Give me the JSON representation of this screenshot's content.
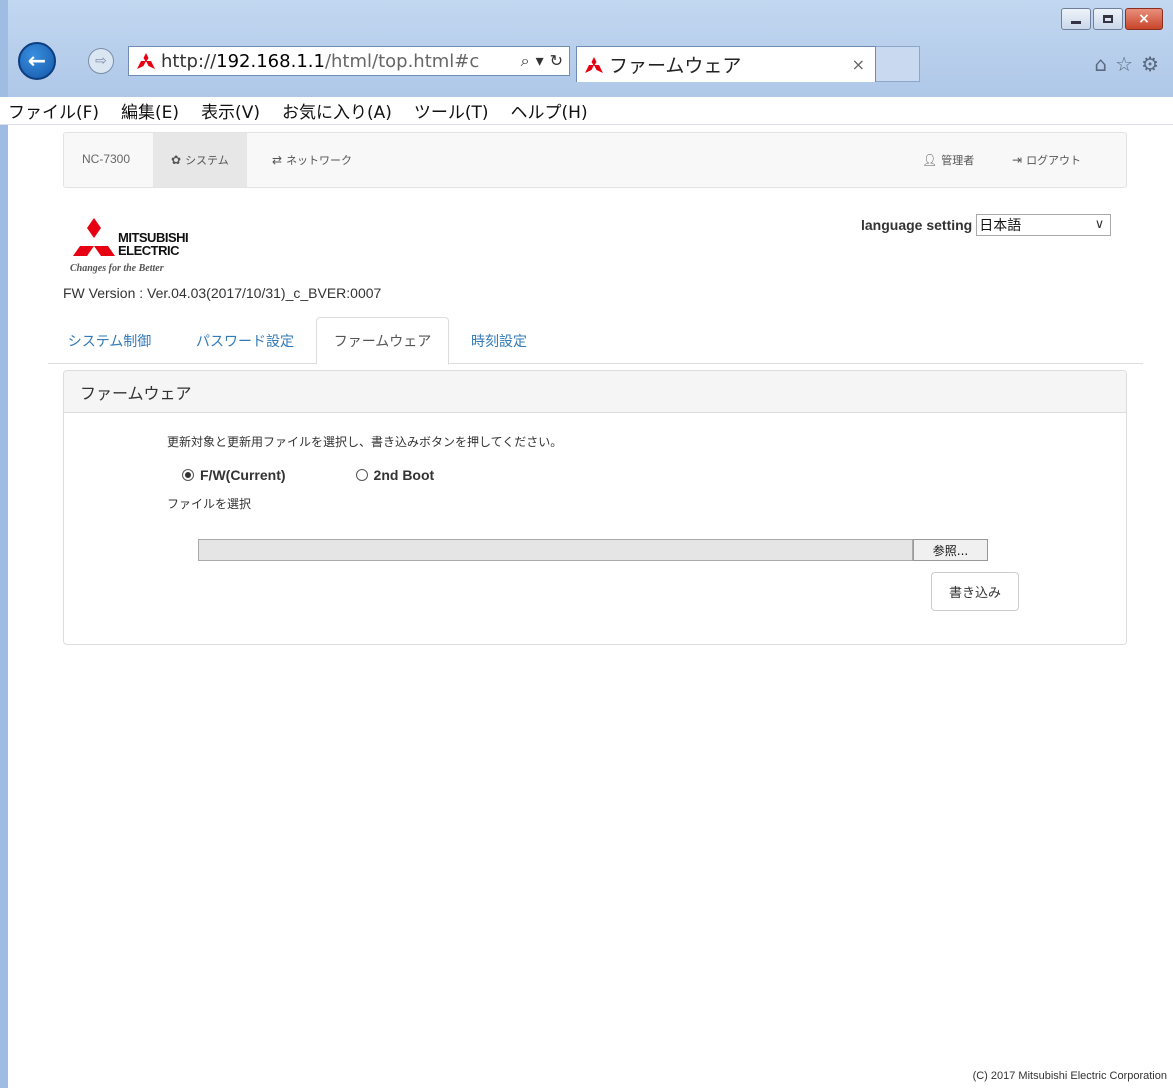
{
  "window": {
    "controls": {
      "minimize": "minimize",
      "maximize": "maximize",
      "close": "×"
    }
  },
  "browser": {
    "url_prefix": "http://",
    "url_host": "192.168.1.1",
    "url_path": "/html/top.html#c",
    "tab_title": "ファームウェア",
    "tab_close": "×",
    "icons": [
      "back-icon",
      "forward-icon",
      "search-icon",
      "refresh-icon",
      "home-icon",
      "favorites-star-icon",
      "settings-gear-icon"
    ]
  },
  "menubar": [
    "ファイル(F)",
    "編集(E)",
    "表示(V)",
    "お気に入り(A)",
    "ツール(T)",
    "ヘルプ(H)"
  ],
  "navbar": {
    "brand": "NC-7300",
    "system": "システム",
    "network": "ネットワーク",
    "admin": "管理者",
    "logout": "ログアウト"
  },
  "header": {
    "logo_line1": "MITSUBISHI",
    "logo_line2": "ELECTRIC",
    "logo_tagline": "Changes for the Better",
    "fw_version": "FW Version : Ver.04.03(2017/10/31)_c_BVER:0007",
    "language_label": "language setting",
    "language_value": "日本語",
    "logo_color": "#e60012"
  },
  "tabs": [
    "システム制御",
    "パスワード設定",
    "ファームウェア",
    "時刻設定"
  ],
  "active_tab": "ファームウェア",
  "panel": {
    "title": "ファームウェア",
    "instruction": "更新対象と更新用ファイルを選択し、書き込みボタンを押してください。",
    "radio_current": "F/W(Current)",
    "radio_2nd": "2nd Boot",
    "selected_radio": "F/W(Current)",
    "file_label": "ファイルを選択",
    "file_value": "",
    "browse": "参照...",
    "write": "書き込み"
  },
  "footer": "(C) 2017 Mitsubishi Electric Corporation",
  "colors": {
    "link": "#337ab7",
    "chrome": "#b7cde9",
    "back_button": "#1a66c0"
  }
}
